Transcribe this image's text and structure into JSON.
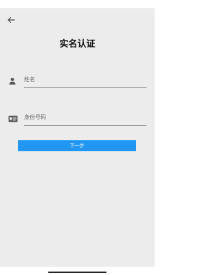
{
  "header": {
    "back_icon": "arrow-left-icon",
    "title": "实名认证"
  },
  "form": {
    "name": {
      "icon": "person-icon",
      "value": "",
      "placeholder": "姓名"
    },
    "id_number": {
      "icon": "id-card-icon",
      "value": "",
      "placeholder": "身份号码"
    },
    "next_label": "下一步"
  },
  "colors": {
    "primary": "#2196f3",
    "background": "#ececec",
    "icon": "#555555"
  }
}
